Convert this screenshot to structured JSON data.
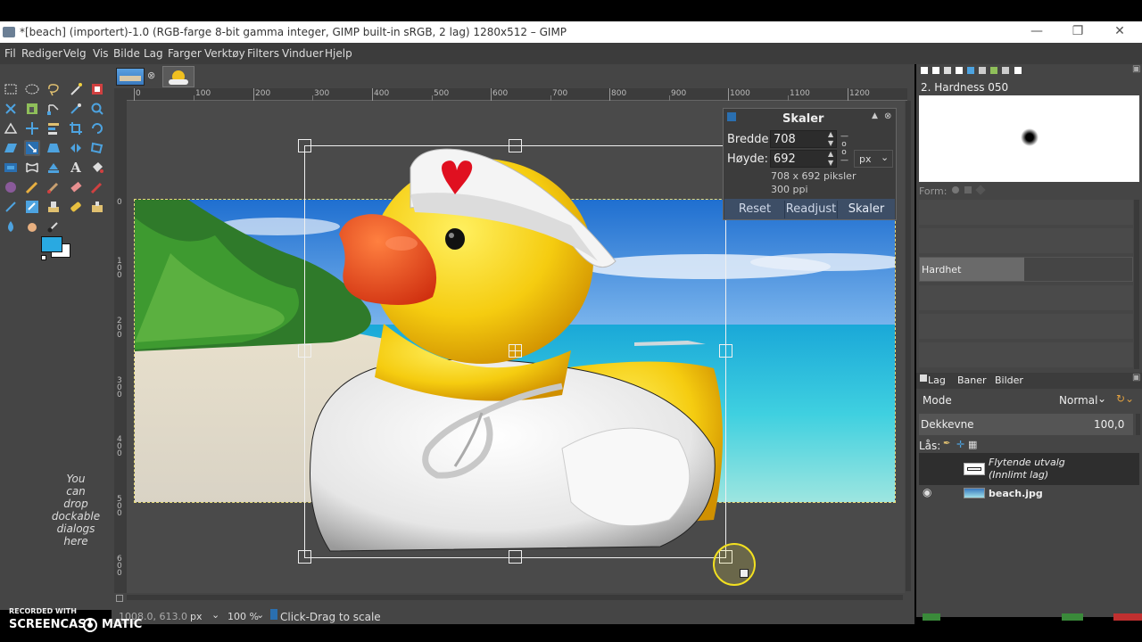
{
  "window": {
    "title": "*[beach] (importert)-1.0 (RGB-farge 8-bit gamma integer, GIMP built-in sRGB, 2 lag) 1280x512 – GIMP"
  },
  "menu": [
    "Fil",
    "Rediger",
    "Velg",
    "Vis",
    "Bilde",
    "Lag",
    "Farger",
    "Verktøy",
    "Filters",
    "Vinduer",
    "Hjelp"
  ],
  "dock_hint": [
    "You",
    "can",
    "drop",
    "dockable",
    "dialogs",
    "here"
  ],
  "ruler": {
    "top": [
      "0",
      "100",
      "200",
      "300",
      "400",
      "500",
      "600",
      "700",
      "800",
      "900",
      "1000",
      "1100",
      "1200"
    ],
    "left": [
      "0",
      "1 0 0",
      "2 0 0",
      "3 0 0",
      "4 0 0",
      "5 0 0",
      "6 0 0"
    ]
  },
  "scale_dialog": {
    "title": "Skaler",
    "width_label": "Bredde:",
    "width_value": "708",
    "height_label": "Høyde:",
    "height_value": "692",
    "unit": "px",
    "size_info": "708 x 692 piksler",
    "resolution": "300 ppi",
    "reset": "Reset",
    "readjust": "Readjust",
    "scale": "Skaler"
  },
  "brushes": {
    "name": "2. Hardness 050",
    "form_label": "Form:",
    "hardness_label": "Hardhet"
  },
  "layers": {
    "tabs": [
      "Lag",
      "Baner",
      "Bilder"
    ],
    "mode_label": "Mode",
    "mode_value": "Normal",
    "opacity_label": "Dekkevne",
    "opacity_value": "100,0",
    "lock_label": "Lås:",
    "items": [
      {
        "name_line1": "Flytende utvalg",
        "name_line2": "(Innlimt lag)"
      },
      {
        "name_line1": "beach.jpg",
        "name_line2": ""
      }
    ]
  },
  "status": {
    "coords": "1008.0, 613.0",
    "unit": "px",
    "zoom": "100 %",
    "message": "Click-Drag to scale"
  },
  "watermark": {
    "line1": "RECORDED WITH",
    "line2_a": "SCREENCAST",
    "line2_b": "MATIC"
  }
}
